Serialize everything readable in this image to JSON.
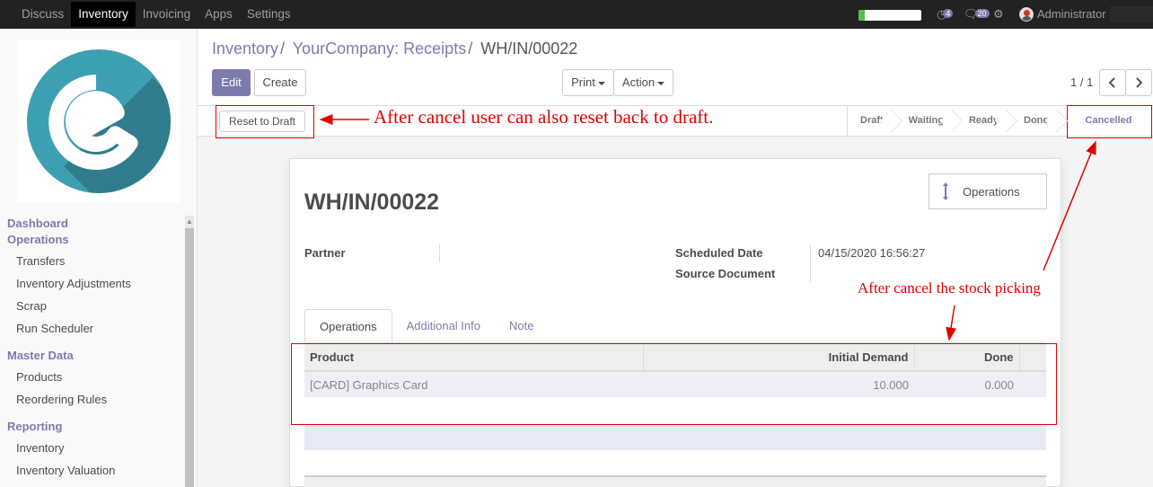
{
  "topbar": {
    "menu": [
      "Discuss",
      "Inventory",
      "Invoicing",
      "Apps",
      "Settings"
    ],
    "active_menu": "Inventory",
    "progress_percent": 10,
    "activity_count": "4",
    "messages_count": "20",
    "user": "Administrator"
  },
  "sidebar": {
    "sections": [
      {
        "title": "Dashboard",
        "items": []
      },
      {
        "title": "Operations",
        "items": [
          "Transfers",
          "Inventory Adjustments",
          "Scrap",
          "Run Scheduler"
        ]
      },
      {
        "title": "Master Data",
        "items": [
          "Products",
          "Reordering Rules"
        ]
      },
      {
        "title": "Reporting",
        "items": [
          "Inventory",
          "Inventory Valuation"
        ]
      }
    ]
  },
  "breadcrumb": {
    "items": [
      "Inventory",
      "YourCompany: Receipts"
    ],
    "current": "WH/IN/00022"
  },
  "buttons": {
    "edit": "Edit",
    "create": "Create",
    "print": "Print",
    "action": "Action",
    "pager": "1 / 1"
  },
  "statusbar": {
    "reset_label": "Reset to Draft",
    "stages": [
      "Draft",
      "Waiting",
      "Ready",
      "Done",
      "Cancelled"
    ],
    "active_stage": "Cancelled"
  },
  "record": {
    "name": "WH/IN/00022",
    "smart_button": "Operations",
    "partner_label": "Partner",
    "partner_value": "",
    "scheduled_label": "Scheduled Date",
    "scheduled_value": "04/15/2020 16:56:27",
    "source_label": "Source Document",
    "source_value": ""
  },
  "tabs": [
    "Operations",
    "Additional Info",
    "Note"
  ],
  "table": {
    "columns": [
      "Product",
      "Initial Demand",
      "Done"
    ],
    "rows": [
      {
        "product": "[CARD] Graphics Card",
        "initial_demand": "10.000",
        "done": "0.000"
      }
    ]
  },
  "annotations": {
    "reset_note": "After cancel user can also reset back to draft.",
    "cancel_note": "After cancel the stock picking",
    "color": "#e00000"
  },
  "colors": {
    "brand": "#7c7bad",
    "navbar": "#222222",
    "logo": "#3d9fb2"
  }
}
